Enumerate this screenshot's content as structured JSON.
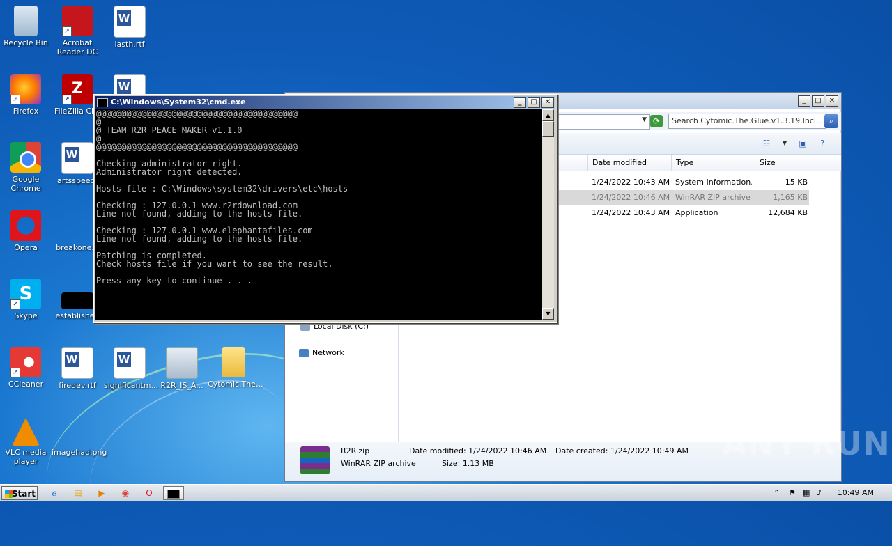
{
  "desktop": {
    "icons": [
      {
        "label": "Recycle Bin"
      },
      {
        "label": "Acrobat Reader DC"
      },
      {
        "label": "lasth.rtf"
      },
      {
        "label": "Firefox"
      },
      {
        "label": "FileZilla Clie"
      },
      {
        "label": ""
      },
      {
        "label": "Google Chrome"
      },
      {
        "label": "artsspeed."
      },
      {
        "label": "Opera"
      },
      {
        "label": "breakone.p"
      },
      {
        "label": "Skype"
      },
      {
        "label": "established"
      },
      {
        "label": "CCleaner"
      },
      {
        "label": "firedev.rtf"
      },
      {
        "label": "significantm..."
      },
      {
        "label": "R2R_IS_A..."
      },
      {
        "label": "Cytomic.The..."
      },
      {
        "label": "VLC media player"
      },
      {
        "label": "imagehad.png"
      }
    ]
  },
  "cmd": {
    "title": "C:\\Windows\\System32\\cmd.exe",
    "lines": [
      "@@@@@@@@@@@@@@@@@@@@@@@@@@@@@@@@@@@@@@@@",
      "@",
      "@ TEAM R2R PEACE MAKER v1.1.0",
      "@",
      "@@@@@@@@@@@@@@@@@@@@@@@@@@@@@@@@@@@@@@@@",
      "",
      "Checking administrator right.",
      "Administrator right detected.",
      "",
      "Hosts file : C:\\Windows\\system32\\drivers\\etc\\hosts",
      "",
      "Checking : 127.0.0.1 www.r2rdownload.com",
      "Line not found, adding to the hosts file.",
      "",
      "Checking : 127.0.0.1 www.elephantafiles.com",
      "Line not found, adding to the hosts file.",
      "",
      "Patching is completed.",
      "Check hosts file if you want to see the result.",
      "",
      "Press any key to continue . . ."
    ]
  },
  "explorer": {
    "search_placeholder": "Search Cytomic.The.Glue.v1.3.19.Incl...",
    "columns": {
      "date": "Date modified",
      "type": "Type",
      "size": "Size"
    },
    "rows": [
      {
        "date": "1/24/2022 10:43 AM",
        "type": "System Information...",
        "size": "15 KB"
      },
      {
        "date": "1/24/2022 10:46 AM",
        "type": "WinRAR ZIP archive",
        "size": "1,165 KB"
      },
      {
        "date": "1/24/2022 10:43 AM",
        "type": "Application",
        "size": "12,684 KB"
      }
    ],
    "nav": {
      "local_disk": "Local Disk (C:)",
      "network": "Network"
    },
    "details": {
      "name": "R2R.zip",
      "kind": "WinRAR ZIP archive",
      "modified": "Date modified: 1/24/2022 10:46 AM",
      "size": "Size: 1.13 MB",
      "created": "Date created: 1/24/2022 10:49 AM"
    }
  },
  "taskbar": {
    "start_label": "Start",
    "clock": "10:49 AM"
  },
  "watermark": "ANY RUN"
}
